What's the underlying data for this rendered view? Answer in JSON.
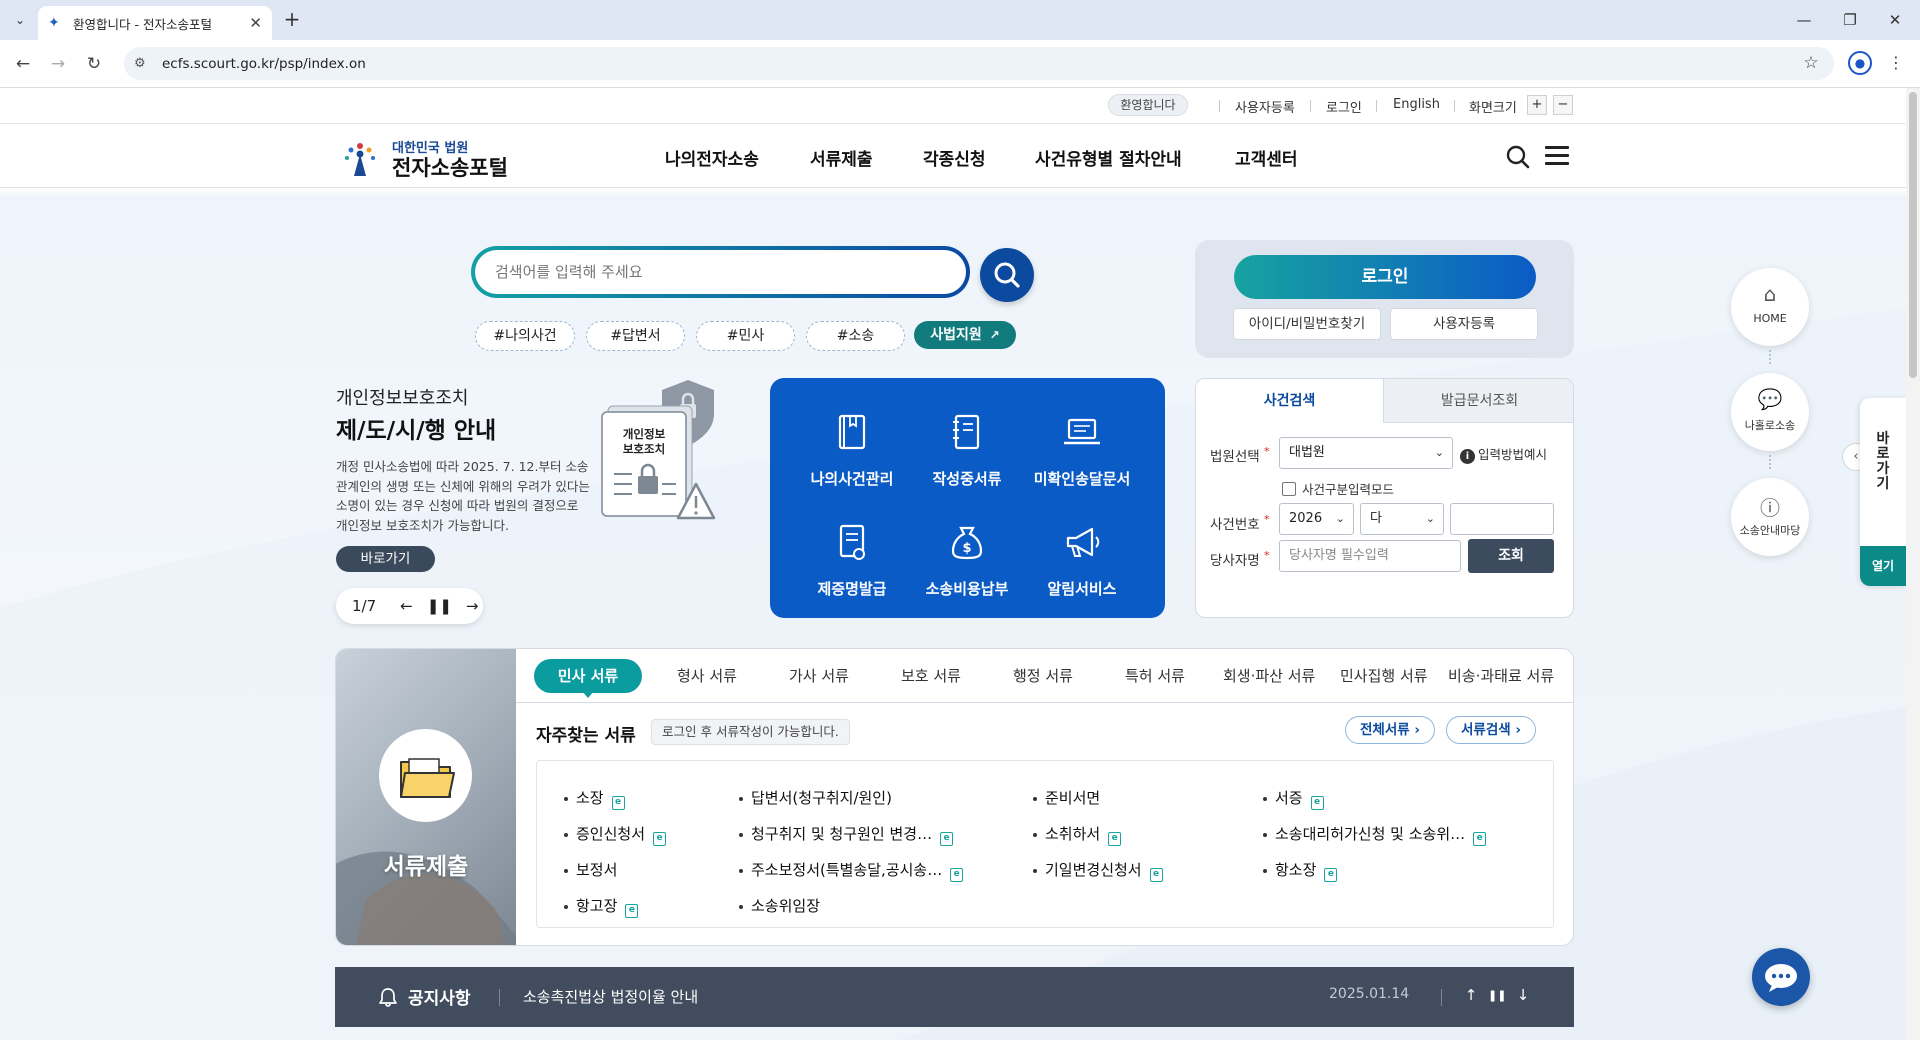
{
  "browser": {
    "tab_title": "환영합니다 - 전자소송포털",
    "tab_close": "✕",
    "new_tab": "+",
    "url": "ecfs.scourt.go.kr/psp/index.on"
  },
  "util": {
    "welcome": "환영합니다",
    "register": "사용자등록",
    "login": "로그인",
    "english": "English",
    "font_size": "화면크기",
    "zoom_in": "+",
    "zoom_out": "−"
  },
  "header": {
    "logo_sub": "대한민국 법원",
    "logo_title": "전자소송포털",
    "nav": [
      "나의전자소송",
      "서류제출",
      "각종신청",
      "사건유형별 절차안내",
      "고객센터"
    ]
  },
  "search": {
    "placeholder": "검색어를 입력해 주세요",
    "tags": [
      "#나의사건",
      "#답변서",
      "#민사",
      "#소송"
    ],
    "judicial_link": "사법지원"
  },
  "promo": {
    "subtitle": "개인정보보호조치",
    "title": "제/도/시/행 안내",
    "description": "개정 민사소송법에 따라 2025. 7. 12.부터 소송 관계인의 생명 또는 신체에 위해의 우려가 있다는 소명이 있는 경우 신청에 따라 법원의 결정으로 개인정보 보호조치가 가능합니다.",
    "go_button": "바로가기",
    "image_label_1": "개인정보",
    "image_label_2": "보호조치",
    "pager": "1/7"
  },
  "quick_menu": [
    {
      "label": "나의사건관리",
      "icon": "book-icon"
    },
    {
      "label": "작성중서류",
      "icon": "notebook-icon"
    },
    {
      "label": "미확인송달문서",
      "icon": "laptop-icon"
    },
    {
      "label": "제증명발급",
      "icon": "certificate-icon"
    },
    {
      "label": "소송비용납부",
      "icon": "money-bag-icon"
    },
    {
      "label": "알림서비스",
      "icon": "megaphone-icon"
    }
  ],
  "login_box": {
    "login_button": "로그인",
    "find_id_pw": "아이디/비밀번호찾기",
    "register": "사용자등록"
  },
  "case_search": {
    "tab_active": "사건검색",
    "tab_other": "발급문서조회",
    "court_label": "법원선택",
    "court_value": "대법원",
    "input_example": "입력방법예시",
    "division_mode": "사건구분입력모드",
    "case_no_label": "사건번호",
    "year_value": "2026",
    "type_value": "다",
    "party_label": "당사자명",
    "party_placeholder": "당사자명 필수입력",
    "submit": "조회",
    "required_mark": "*"
  },
  "documents": {
    "side_title": "서류제출",
    "tabs": [
      "민사 서류",
      "형사 서류",
      "가사 서류",
      "보호 서류",
      "행정 서류",
      "특허 서류",
      "회생·파산 서류",
      "민사집행 서류",
      "비송·과태료 서류"
    ],
    "freq_title": "자주찾는 서류",
    "freq_note": "로그인 후 서류작성이 가능합니다.",
    "all_docs": "전체서류",
    "doc_search": "서류검색",
    "items": [
      {
        "label": "소장",
        "e": true
      },
      {
        "label": "답변서(청구취지/원인)",
        "e": false
      },
      {
        "label": "준비서면",
        "e": false
      },
      {
        "label": "서증",
        "e": true
      },
      {
        "label": "증인신청서",
        "e": true
      },
      {
        "label": "청구취지 및 청구원인 변경…",
        "e": true
      },
      {
        "label": "소취하서",
        "e": true
      },
      {
        "label": "소송대리허가신청 및 소송위…",
        "e": true
      },
      {
        "label": "보정서",
        "e": false
      },
      {
        "label": "주소보정서(특별송달,공시송…",
        "e": true
      },
      {
        "label": "기일변경신청서",
        "e": true
      },
      {
        "label": "항소장",
        "e": true
      },
      {
        "label": "항고장",
        "e": true
      },
      {
        "label": "소송위임장",
        "e": false
      }
    ],
    "e_mark": "e"
  },
  "notice": {
    "title": "공지사항",
    "text": "소송촉진법상 법정이율 안내",
    "date": "2025.01.14"
  },
  "floating": {
    "home": "HOME",
    "community": "나홀로소송",
    "guide": "소송안내마당",
    "goto": "바로가기",
    "open": "열기"
  },
  "colors": {
    "brand_blue": "#0b5bc6",
    "brand_teal": "#0b9ca0",
    "notice_bg": "#414d5e"
  }
}
